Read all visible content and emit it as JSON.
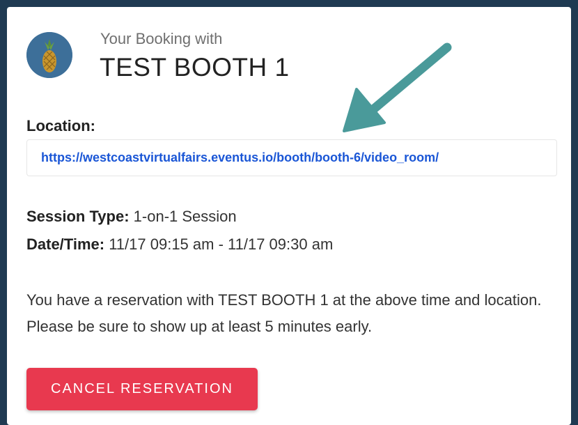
{
  "header": {
    "subtitle": "Your Booking with",
    "title": "TEST BOOTH 1"
  },
  "location": {
    "label": "Location:",
    "url": "https://westcoastvirtualfairs.eventus.io/booth/booth-6/video_room/"
  },
  "details": {
    "session_type_label": "Session Type:",
    "session_type_value": "1-on-1 Session",
    "datetime_label": "Date/Time:",
    "datetime_value": "11/17 09:15 am - 11/17 09:30 am"
  },
  "message": "You have a reservation with TEST BOOTH 1 at the above time and location. Please be sure to show up at least 5 minutes early.",
  "actions": {
    "cancel_label": "CANCEL RESERVATION"
  },
  "colors": {
    "page_background": "#1f3a52",
    "link": "#1a56d6",
    "cancel_button": "#e8394f",
    "arrow": "#4a9a9a"
  },
  "icons": {
    "avatar": "pineapple-icon",
    "annotation": "arrow-icon"
  }
}
